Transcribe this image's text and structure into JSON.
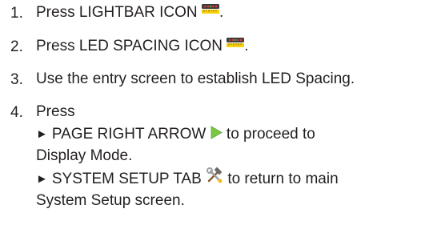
{
  "steps": [
    {
      "number": "1.",
      "text_before": "Press LIGHTBAR ICON",
      "icon": "lightbar-icon",
      "text_after": "."
    },
    {
      "number": "2.",
      "text_before": "Press LED SPACING ICON",
      "icon": "led-spacing-icon",
      "text_after": "."
    },
    {
      "number": "3.",
      "text": "Use the entry screen to establish LED Spacing."
    },
    {
      "number": "4.",
      "text": "Press",
      "options": [
        {
          "bullet": "►",
          "text_before": "PAGE RIGHT ARROW",
          "icon": "page-right-arrow-icon",
          "text_after": "to proceed to",
          "continuation": "Display Mode."
        },
        {
          "bullet": "►",
          "text_before": "SYSTEM SETUP TAB",
          "icon": "system-setup-tools-icon",
          "text_after": "to return to main",
          "continuation": "System Setup screen."
        }
      ]
    }
  ],
  "colors": {
    "text": "#231f20",
    "arrow": "#7ac943",
    "lightbar_top": "#3b3b3b",
    "lightbar_bottom": "#f6d10e"
  }
}
